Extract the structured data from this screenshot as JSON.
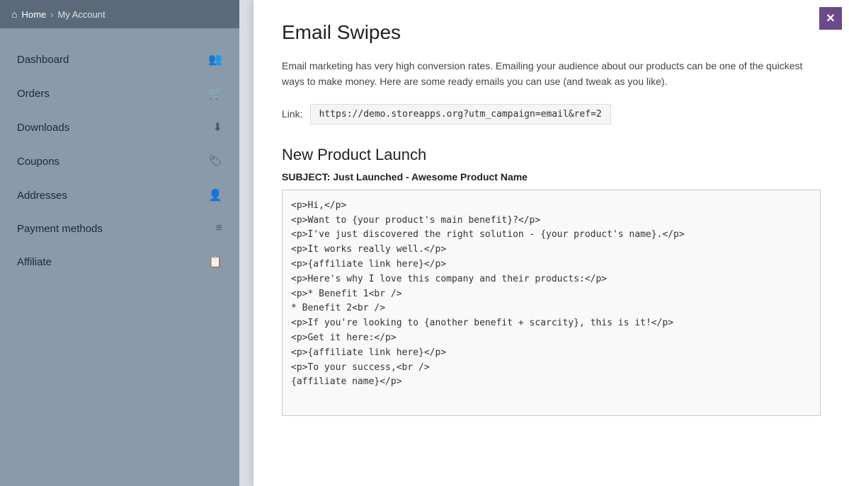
{
  "header": {
    "home_label": "Home",
    "breadcrumb_sep": "›",
    "breadcrumb_current": "My Account"
  },
  "sidebar": {
    "items": [
      {
        "id": "dashboard",
        "label": "Dashboard",
        "icon": "👥"
      },
      {
        "id": "orders",
        "label": "Orders",
        "icon": "🛒"
      },
      {
        "id": "downloads",
        "label": "Downloads",
        "icon": "⬇"
      },
      {
        "id": "coupons",
        "label": "Coupons",
        "icon": "🏷"
      },
      {
        "id": "addresses",
        "label": "Addresses",
        "icon": "👤"
      },
      {
        "id": "payment-methods",
        "label": "Payment methods",
        "icon": "≡"
      },
      {
        "id": "affiliate",
        "label": "Affiliate",
        "icon": "📋"
      }
    ]
  },
  "modal": {
    "title": "Email Swipes",
    "description": "Email marketing has very high conversion rates. Emailing your audience about our products can be one of the quickest ways to make money. Here are some ready emails you can use (and tweak as you like).",
    "link_label": "Link:",
    "link_url": "https://demo.storeapps.org?utm_campaign=email&ref=2",
    "close_icon": "✕",
    "section_title": "New Product Launch",
    "subject_label": "SUBJECT: Just Launched - Awesome Product Name",
    "email_body": "<p>Hi,</p>\n<p>Want to {your product's main benefit}?</p>\n<p>I've just discovered the right solution - {your product's name}.</p>\n<p>It works really well.</p>\n<p>{affiliate link here}</p>\n<p>Here's why I love this company and their products:</p>\n<p>* Benefit 1<br />\n* Benefit 2<br />\n<p>If you're looking to {another benefit + scarcity}, this is it!</p>\n<p>Get it here:</p>\n<p>{affiliate link here}</p>\n<p>To your success,<br />\n{affiliate name}</p>"
  }
}
